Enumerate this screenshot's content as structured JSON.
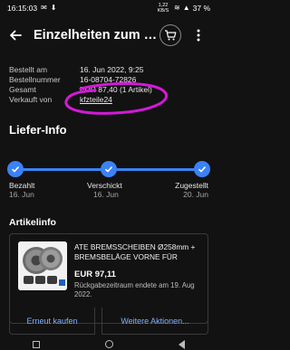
{
  "status_bar": {
    "time": "16:15:03",
    "network_speed": "1,22 KB/S",
    "battery": "37 %"
  },
  "app_bar": {
    "title": "Einzelheiten zum Kauf"
  },
  "order_info": {
    "rows": [
      {
        "label": "Bestellt am",
        "value": "16. Jun 2022, 9:25"
      },
      {
        "label": "Bestellnummer",
        "value": "16-08704-72826"
      },
      {
        "label": "Gesamt",
        "value": "EUR 87,40 (1 Artikel)"
      },
      {
        "label": "Verkauft von",
        "value": "kfzteile24"
      }
    ]
  },
  "delivery": {
    "heading": "Liefer-Info",
    "steps": [
      {
        "label": "Bezahlt",
        "date": "16. Jun"
      },
      {
        "label": "Verschickt",
        "date": "16. Jun"
      },
      {
        "label": "Zugestellt",
        "date": "20. Jun"
      }
    ]
  },
  "item": {
    "heading": "Artikelinfo",
    "title": "ATE BREMSSCHEIBEN Ø258mm + BREMSBELÄGE VORNE FÜR",
    "price": "EUR 97,11",
    "return_note": "Rückgabezeitraum endete am 19. Aug 2022."
  },
  "actions": {
    "buy_again": "Erneut kaufen",
    "more_actions": "Weitere Aktionen..."
  },
  "colors": {
    "accent": "#3b82f6",
    "highlight": "#d21ad6"
  }
}
